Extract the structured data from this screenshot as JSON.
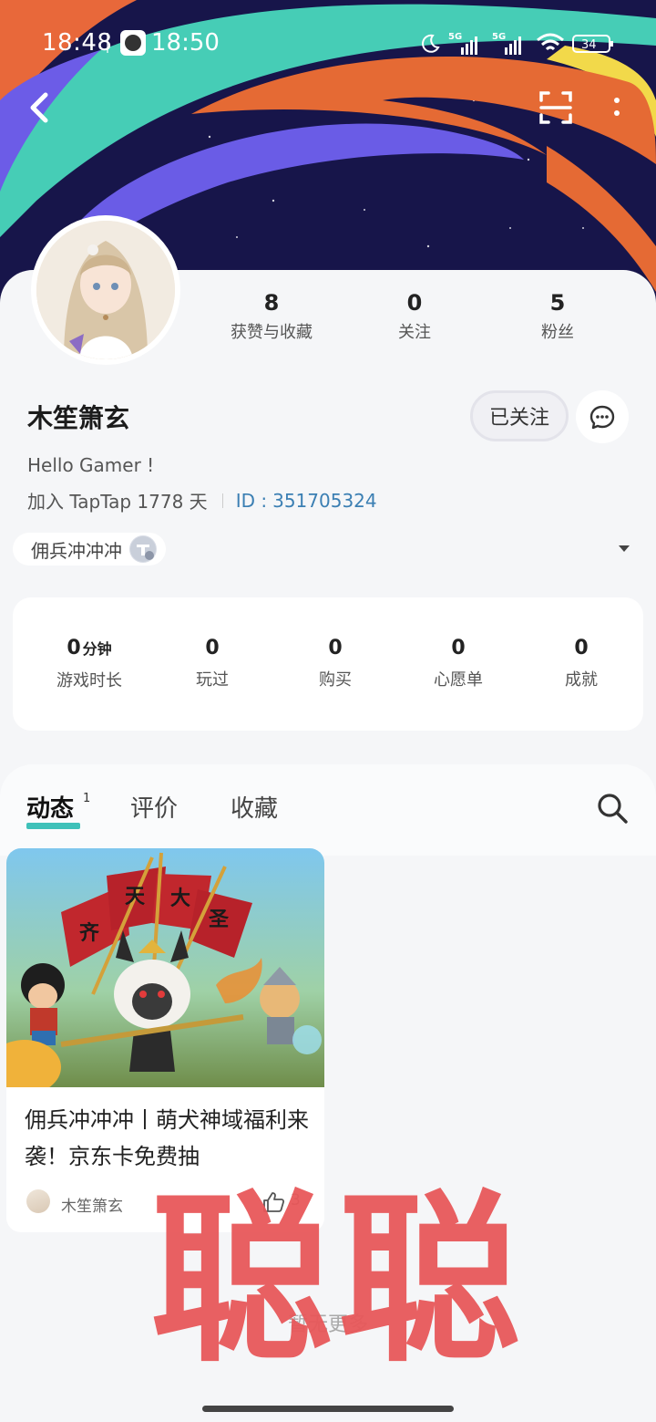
{
  "status_bar": {
    "time_primary": "18:48",
    "time_secondary": "18:50",
    "network_1": "5G",
    "network_2": "5G",
    "battery": "34"
  },
  "nav": {
    "back_icon": "chevron-left-icon",
    "scan_icon": "scan-icon",
    "more_icon": "more-vertical-icon"
  },
  "profile": {
    "stats": [
      {
        "value": "8",
        "label": "获赞与收藏"
      },
      {
        "value": "0",
        "label": "关注"
      },
      {
        "value": "5",
        "label": "粉丝"
      }
    ],
    "username": "木笙箫玄",
    "follow_label": "已关注",
    "bio": "Hello Gamer !",
    "join_text": "加入 TapTap 1778 天",
    "id_label": "ID :",
    "id_value": "351705324",
    "game_tag": "佣兵冲冲冲"
  },
  "game_stats": [
    {
      "value": "0",
      "unit": "分钟",
      "label": "游戏时长"
    },
    {
      "value": "0",
      "unit": "",
      "label": "玩过"
    },
    {
      "value": "0",
      "unit": "",
      "label": "购买"
    },
    {
      "value": "0",
      "unit": "",
      "label": "心愿单"
    },
    {
      "value": "0",
      "unit": "",
      "label": "成就"
    }
  ],
  "tabs": {
    "items": [
      {
        "label": "动态",
        "badge": "1"
      },
      {
        "label": "评价"
      },
      {
        "label": "收藏"
      }
    ],
    "active": 0
  },
  "post": {
    "title": "佣兵冲冲冲丨萌犬神域福利来袭！京东卡免费抽",
    "author": "木笙箫玄",
    "likes": "3",
    "banner_flags": [
      "齐",
      "天",
      "大",
      "圣"
    ]
  },
  "footer": {
    "no_more": "暂无更多"
  },
  "watermark": "聪聪",
  "colors": {
    "accent": "#3fc1b9",
    "id_blue": "#3b7fb3",
    "watermark": "#e8585a",
    "banner_bg": "#17154a"
  }
}
